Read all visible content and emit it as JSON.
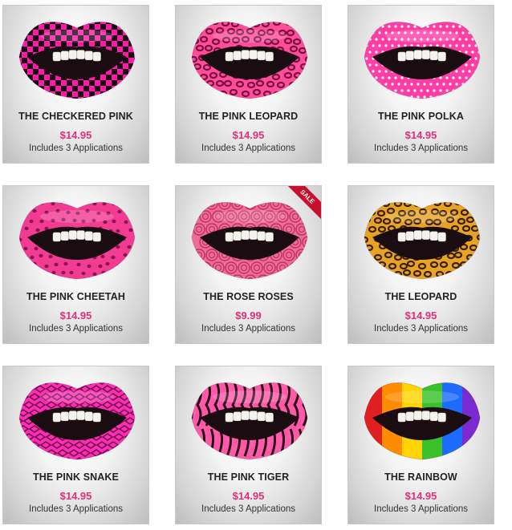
{
  "products": [
    {
      "name": "THE CHECKERED PINK",
      "price": "$14.95",
      "note": "Includes 3 Applications",
      "pattern": "checkered",
      "colors": [
        "#ff1aa8",
        "#1a0a14"
      ],
      "sale": false
    },
    {
      "name": "THE PINK LEOPARD",
      "price": "$14.95",
      "note": "Includes 3 Applications",
      "pattern": "leopard",
      "colors": [
        "#ff4d9a",
        "#7a1040"
      ],
      "sale": false
    },
    {
      "name": "THE PINK POLKA",
      "price": "$14.95",
      "note": "Includes 3 Applications",
      "pattern": "polka",
      "colors": [
        "#ff3ea5",
        "#ffffff"
      ],
      "sale": false
    },
    {
      "name": "THE PINK CHEETAH",
      "price": "$14.95",
      "note": "Includes 3 Applications",
      "pattern": "cheetah",
      "colors": [
        "#f23b93",
        "#8a1450"
      ],
      "sale": false
    },
    {
      "name": "THE ROSE ROSES",
      "price": "$9.99",
      "note": "Includes 3 Applications",
      "pattern": "roses",
      "colors": [
        "#f06a96",
        "#b32a5c"
      ],
      "sale": true,
      "sale_label": "SALE"
    },
    {
      "name": "THE LEOPARD",
      "price": "$14.95",
      "note": "Includes 3 Applications",
      "pattern": "leopard",
      "colors": [
        "#e8a325",
        "#3a2108"
      ],
      "sale": false
    },
    {
      "name": "THE PINK SNAKE",
      "price": "$14.95",
      "note": "Includes 3 Applications",
      "pattern": "snake",
      "colors": [
        "#ff2db4",
        "#6e0f4c"
      ],
      "sale": false
    },
    {
      "name": "THE PINK TIGER",
      "price": "$14.95",
      "note": "Includes 3 Applications",
      "pattern": "tiger",
      "colors": [
        "#ff5aa8",
        "#2a0a18"
      ],
      "sale": false
    },
    {
      "name": "THE RAINBOW",
      "price": "$14.95",
      "note": "Includes 3 Applications",
      "pattern": "rainbow",
      "colors": [
        "#e02020",
        "#ff8c00",
        "#ffd400",
        "#39c02a",
        "#1e6cff",
        "#7a2ad0"
      ],
      "sale": false
    }
  ]
}
